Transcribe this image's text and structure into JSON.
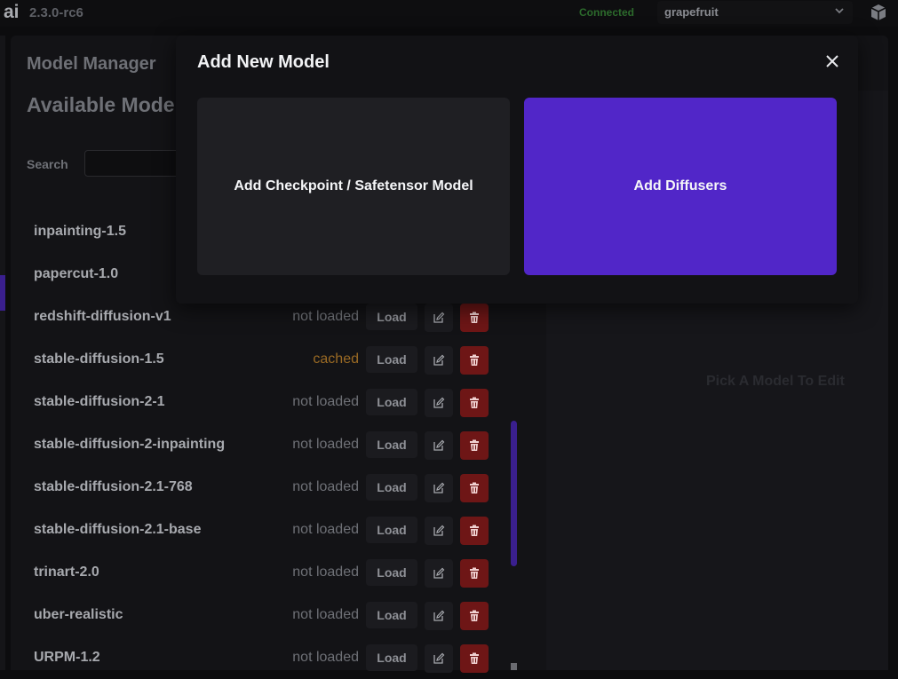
{
  "header": {
    "logo": "ai",
    "version": "2.3.0-rc6",
    "status": "Connected",
    "model_select": "grapefruit",
    "chevron_icon": "chevron-down-icon",
    "cube_icon": "cube-icon"
  },
  "model_manager": {
    "title": "Model Manager",
    "available_title": "Available Mode",
    "search_label": "Search",
    "search_value": "",
    "pick_text": "Pick A Model To Edit",
    "load_label": "Load",
    "models": [
      {
        "name": "inpainting-1.5",
        "status": ""
      },
      {
        "name": "papercut-1.0",
        "status": ""
      },
      {
        "name": "redshift-diffusion-v1",
        "status": "not loaded"
      },
      {
        "name": "stable-diffusion-1.5",
        "status": "cached"
      },
      {
        "name": "stable-diffusion-2-1",
        "status": "not loaded"
      },
      {
        "name": "stable-diffusion-2-inpainting",
        "status": "not loaded"
      },
      {
        "name": "stable-diffusion-2.1-768",
        "status": "not loaded"
      },
      {
        "name": "stable-diffusion-2.1-base",
        "status": "not loaded"
      },
      {
        "name": "trinart-2.0",
        "status": "not loaded"
      },
      {
        "name": "uber-realistic",
        "status": "not loaded"
      },
      {
        "name": "URPM-1.2",
        "status": "not loaded"
      }
    ]
  },
  "modal": {
    "title": "Add New Model",
    "close_icon": "close-icon",
    "checkpoint_label": "Add Checkpoint / Safetensor Model",
    "diffusers_label": "Add Diffusers"
  },
  "colors": {
    "accent": "#5126c8",
    "delete": "#6e1616",
    "cached": "#9a6a24",
    "connected": "#2c6a2c"
  }
}
